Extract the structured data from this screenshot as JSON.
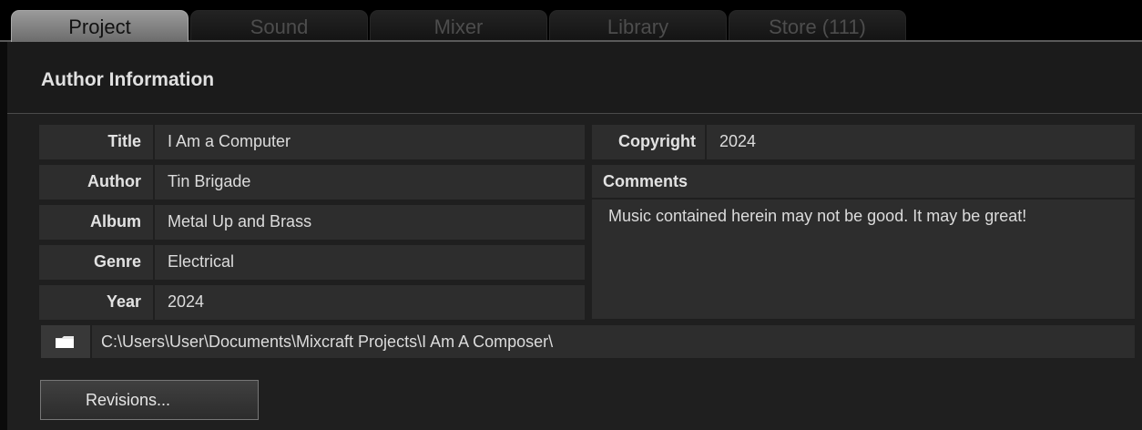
{
  "tabs": [
    {
      "label": "Project"
    },
    {
      "label": "Sound"
    },
    {
      "label": "Mixer"
    },
    {
      "label": "Library"
    },
    {
      "label": "Store (111)"
    }
  ],
  "active_tab": "Project",
  "section": {
    "title": "Author Information"
  },
  "fields": {
    "title": {
      "label": "Title",
      "value": "I Am a Computer"
    },
    "author": {
      "label": "Author",
      "value": "Tin Brigade"
    },
    "album": {
      "label": "Album",
      "value": "Metal Up and Brass"
    },
    "genre": {
      "label": "Genre",
      "value": "Electrical"
    },
    "year": {
      "label": "Year",
      "value": "2024"
    },
    "copyright": {
      "label": "Copyright",
      "value": "2024"
    },
    "comments": {
      "label": "Comments",
      "value": "Music contained herein may not be good.  It may be great!"
    }
  },
  "project_path": "C:\\Users\\User\\Documents\\Mixcraft Projects\\I Am A Composer\\",
  "buttons": {
    "revisions": "Revisions..."
  },
  "icons": {
    "folder": "folder-icon"
  },
  "colors": {
    "background": "#1f1f1f",
    "field": "#2d2d2d",
    "active_tab": "#8c8c8c"
  }
}
